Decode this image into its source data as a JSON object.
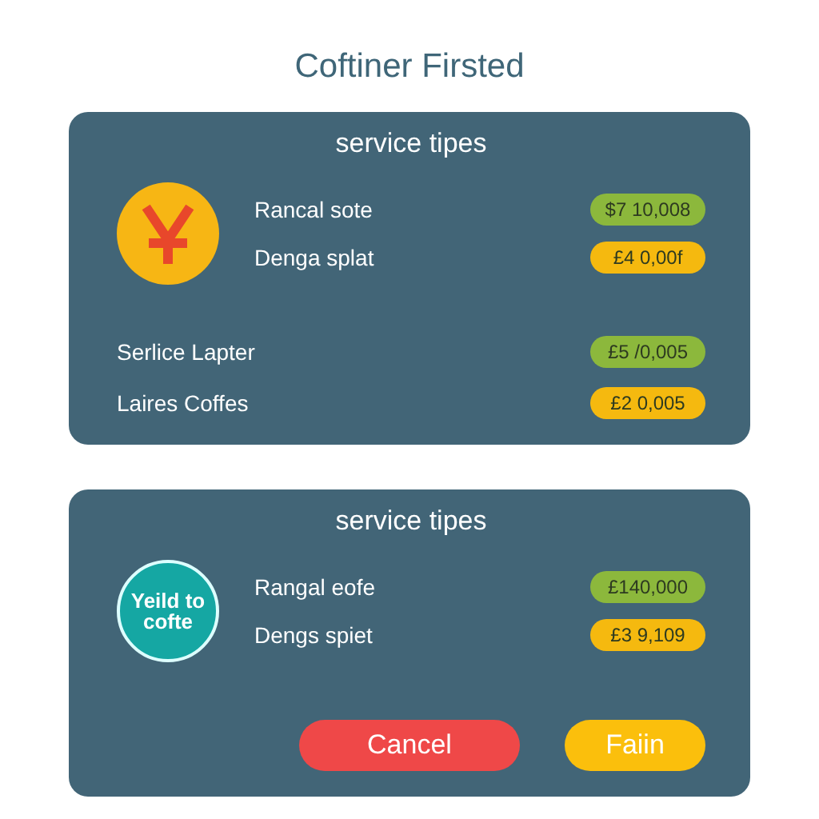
{
  "title": "Coftiner Firsted",
  "cards": [
    {
      "heading": "service tipes",
      "badge": {
        "kind": "yen"
      },
      "rows": [
        {
          "label": "Rancal sote",
          "amount": "$7 10,008",
          "color": "#8cb83c"
        },
        {
          "label": "Denga splat",
          "amount": "£4 0,00f",
          "color": "#f5b90f"
        }
      ],
      "extra_rows": [
        {
          "label": "Serlice Lapter",
          "amount": "£5 /0,005",
          "color": "#8cb83c"
        },
        {
          "label": "Laires Coffes",
          "amount": "£2 0,005",
          "color": "#f5b90f"
        }
      ]
    },
    {
      "heading": "service tipes",
      "badge": {
        "kind": "text",
        "text": "Yeild to cofte"
      },
      "rows": [
        {
          "label": "Rangal eofe",
          "amount": "£140,000",
          "color": "#8cb83c"
        },
        {
          "label": "Dengs spiet",
          "amount": "£3 9,109",
          "color": "#f5b90f"
        }
      ],
      "buttons": [
        {
          "label": "Cancel",
          "kind": "danger"
        },
        {
          "label": "Faiin",
          "kind": "warning"
        }
      ]
    }
  ]
}
